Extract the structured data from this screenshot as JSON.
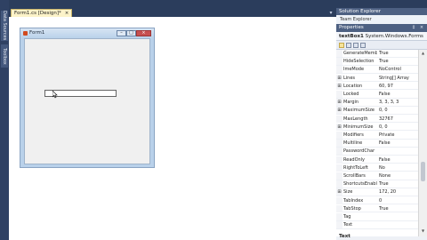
{
  "left_strip": {
    "tabs": [
      {
        "label": "Data Sources"
      },
      {
        "label": "Toolbox"
      }
    ]
  },
  "document_tabs": [
    {
      "label": "Form1.cs [Design]*",
      "close": "×"
    }
  ],
  "form_window": {
    "title": "Form1",
    "min_glyph": "–",
    "max_glyph": "□",
    "close_glyph": "×"
  },
  "solution_explorer": {
    "title": "Solution Explorer",
    "content": "Team Explorer"
  },
  "properties": {
    "title": "Properties",
    "pin": "‡",
    "close": "×",
    "object_name": "textBox1",
    "object_type": "System.Windows.Forms",
    "description_title": "Text",
    "rows": [
      {
        "expand": "",
        "name": "GenerateMember",
        "value": "True"
      },
      {
        "expand": "",
        "name": "HideSelection",
        "value": "True"
      },
      {
        "expand": "",
        "name": "ImeMode",
        "value": "NoControl"
      },
      {
        "expand": "⊞",
        "name": "Lines",
        "value": "String[] Array"
      },
      {
        "expand": "⊞",
        "name": "Location",
        "value": "60, 97"
      },
      {
        "expand": "",
        "name": "Locked",
        "value": "False"
      },
      {
        "expand": "⊞",
        "name": "Margin",
        "value": "3, 3, 3, 3"
      },
      {
        "expand": "⊞",
        "name": "MaximumSize",
        "value": "0, 0"
      },
      {
        "expand": "",
        "name": "MaxLength",
        "value": "32767"
      },
      {
        "expand": "⊞",
        "name": "MinimumSize",
        "value": "0, 0"
      },
      {
        "expand": "",
        "name": "Modifiers",
        "value": "Private"
      },
      {
        "expand": "",
        "name": "Multiline",
        "value": "False"
      },
      {
        "expand": "",
        "name": "PasswordChar",
        "value": ""
      },
      {
        "expand": "",
        "name": "ReadOnly",
        "value": "False"
      },
      {
        "expand": "",
        "name": "RightToLeft",
        "value": "No"
      },
      {
        "expand": "",
        "name": "ScrollBars",
        "value": "None"
      },
      {
        "expand": "",
        "name": "ShortcutsEnabled",
        "value": "True"
      },
      {
        "expand": "⊞",
        "name": "Size",
        "value": "172, 20"
      },
      {
        "expand": "",
        "name": "TabIndex",
        "value": "0"
      },
      {
        "expand": "",
        "name": "TabStop",
        "value": "True"
      },
      {
        "expand": "",
        "name": "Tag",
        "value": ""
      },
      {
        "expand": "",
        "name": "Text",
        "value": ""
      }
    ]
  },
  "colors": {
    "ide_background": "#2b3d5c",
    "panel_header": "#4d6082",
    "active_doc_tab": "#fcf3c9",
    "form_chrome": "#b9d1ea",
    "form_client": "#f0f0f0"
  }
}
